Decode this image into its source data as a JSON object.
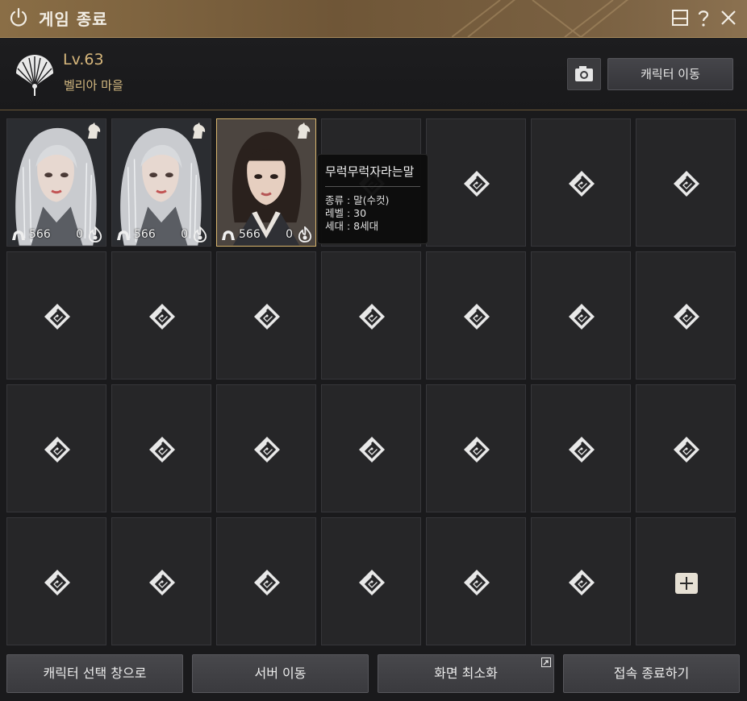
{
  "window": {
    "title": "게임 종료",
    "icons": [
      "power-icon",
      "minimize-panel-icon",
      "help-icon",
      "close-icon"
    ]
  },
  "header": {
    "level": "Lv.63",
    "location": "벨리아 마을",
    "move_character_label": "캐릭터 이동",
    "icons": [
      "fan-emblem-icon",
      "camera-icon"
    ]
  },
  "characters": [
    {
      "left_value": "566",
      "right_value": "0"
    },
    {
      "left_value": "566",
      "right_value": "0"
    },
    {
      "left_value": "566",
      "right_value": "0",
      "selected": true
    }
  ],
  "tooltip": {
    "name": "무럭무럭자라는말",
    "type": "종류 : 말(수컷)",
    "level": "레벨 : 30",
    "generation": "세대 : 8세대"
  },
  "grid": {
    "columns": 7,
    "rows": 4,
    "filled_slots": 3,
    "add_slot_icon": "plus-icon",
    "empty_slot_icon": "empty-slot-icon"
  },
  "footer": {
    "char_select_label": "캐릭터 선택 창으로",
    "server_move_label": "서버 이동",
    "minimize_label": "화면 최소화",
    "exit_label": "접속 종료하기"
  },
  "colors": {
    "accent_gold": "#d7b77c",
    "titlebar": "#7a6142",
    "panel": "#262628"
  }
}
